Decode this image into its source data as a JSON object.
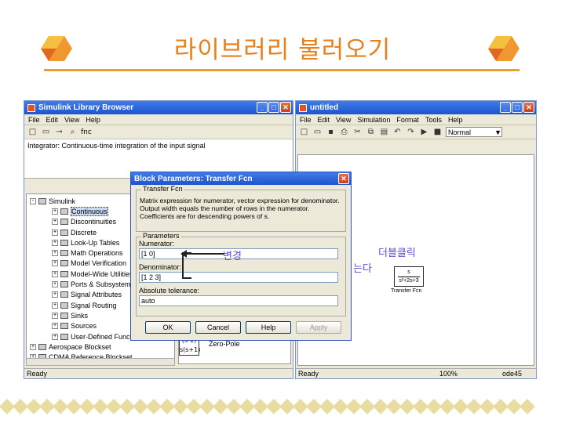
{
  "slide": {
    "title": "라이브러리 불러오기"
  },
  "library_browser": {
    "title": "Simulink Library Browser",
    "menu": [
      "File",
      "Edit",
      "View",
      "Help"
    ],
    "search_text": "fnc",
    "description": "Integrator: Continuous-time integration of the input signal",
    "tree": [
      {
        "label": "Simulink",
        "expander": "-",
        "level": 0
      },
      {
        "label": "Continuous",
        "expander": "+",
        "level": 1,
        "selected": true
      },
      {
        "label": "Discontinuities",
        "expander": "+",
        "level": 1
      },
      {
        "label": "Discrete",
        "expander": "+",
        "level": 1
      },
      {
        "label": "Look-Up Tables",
        "expander": "+",
        "level": 1
      },
      {
        "label": "Math Operations",
        "expander": "+",
        "level": 1
      },
      {
        "label": "Model Verification",
        "expander": "+",
        "level": 1
      },
      {
        "label": "Model-Wide Utilities",
        "expander": "+",
        "level": 1
      },
      {
        "label": "Ports & Subsystems",
        "expander": "+",
        "level": 1
      },
      {
        "label": "Signal Attributes",
        "expander": "+",
        "level": 1
      },
      {
        "label": "Signal Routing",
        "expander": "+",
        "level": 1
      },
      {
        "label": "Sinks",
        "expander": "+",
        "level": 1
      },
      {
        "label": "Sources",
        "expander": "+",
        "level": 1
      },
      {
        "label": "User-Defined Functi",
        "expander": "+",
        "level": 1
      },
      {
        "label": "Aerospace Blockset",
        "expander": "+",
        "level": 0
      },
      {
        "label": "CDMA Reference Blockset",
        "expander": "+",
        "level": 0
      }
    ],
    "zero_pole": {
      "label": "Zero-Pole",
      "icon_top": "(s-1)",
      "icon_bottom": "s(s+1)"
    },
    "status": "Ready"
  },
  "model_window": {
    "title": "untitled",
    "menu": [
      "File",
      "Edit",
      "View",
      "Simulation",
      "Format",
      "Tools",
      "Help"
    ],
    "sim_mode": "Normal",
    "block": {
      "numerator": "s",
      "denominator": "s²+2s+3",
      "caption": "Transfer Fcn"
    },
    "status_left": "Ready",
    "status_zoom": "100%",
    "status_solver": "ode45"
  },
  "dialog": {
    "title": "Block Parameters: Transfer Fcn",
    "group_title": "Transfer Fcn",
    "group_text": "Matrix expression for numerator, vector expression for denominator. Output width equals the number of rows in the numerator. Coefficients are for descending powers of s.",
    "params_title": "Parameters",
    "numerator_label": "Numerator:",
    "numerator_value": "[1 0]",
    "denominator_label": "Denominator:",
    "denominator_value": "[1 2 3]",
    "tolerance_label": "Absolute tolerance:",
    "tolerance_value": "auto",
    "buttons": {
      "ok": "OK",
      "cancel": "Cancel",
      "help": "Help",
      "apply": "Apply"
    }
  },
  "annotations": {
    "change": "변경",
    "double_click": "더블클릭",
    "partial": "는다"
  },
  "colors": {
    "title": "#e8801a",
    "annotation": "#5b4fd0",
    "titlebar": "#1d54d0"
  }
}
